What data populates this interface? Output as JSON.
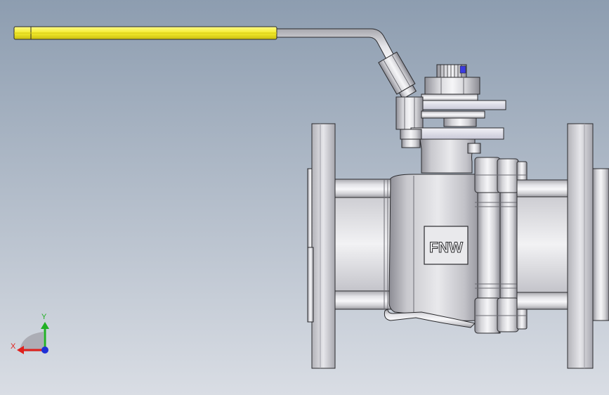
{
  "viewport": {
    "background_top": "#8d9db0",
    "background_bottom": "#d9dde4"
  },
  "model": {
    "brand_plate_text": "FNW",
    "handle_grip_color": "#f4ec2a",
    "metal_light": "#f4f4f6",
    "metal_mid": "#c8c8cc",
    "metal_dark": "#8f8f96",
    "outline": "#2b2b2e"
  },
  "triad": {
    "x_label": "X",
    "y_label": "Y",
    "x_color": "#e0201c",
    "y_color": "#21b024",
    "z_color": "#1f2fd6"
  }
}
